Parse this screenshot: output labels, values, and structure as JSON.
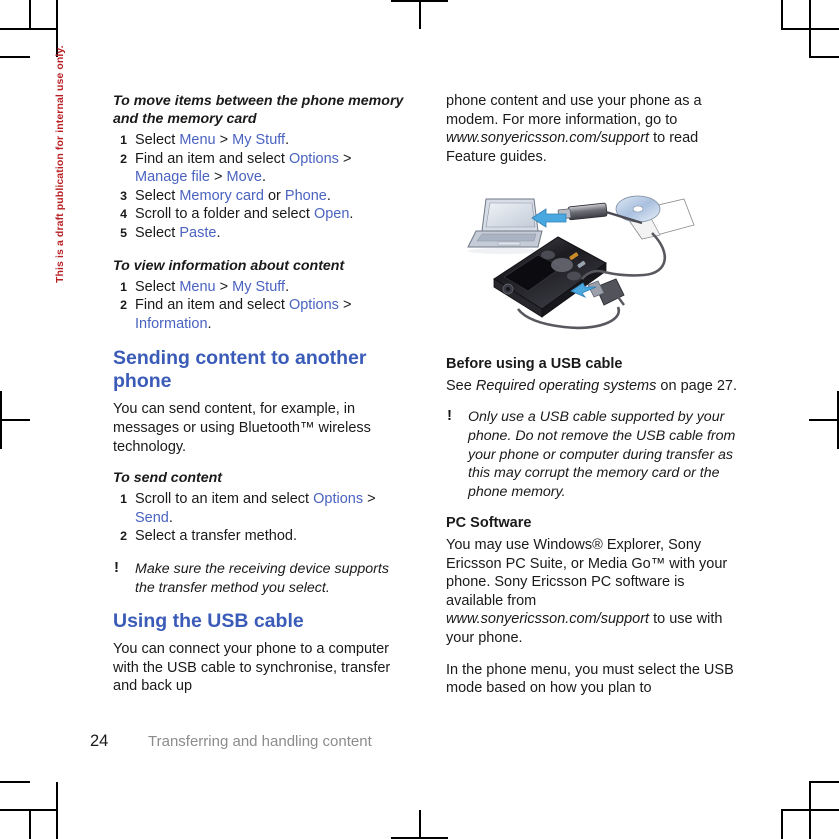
{
  "document": {
    "draft_stamp": "This is a draft publication for internal use only.",
    "footer": {
      "page_number": "24",
      "chapter_title": "Transferring and handling content"
    },
    "accent_heading_color": "#3a5bb7",
    "link_color": "#4a63c0",
    "stamp_color": "#b81f23"
  },
  "left_column": {
    "proc_move": {
      "heading": "To move items between the phone memory and the memory card",
      "steps": [
        {
          "parts": [
            {
              "t": "Select ",
              "s": "plain"
            },
            {
              "t": "Menu",
              "s": "link"
            },
            {
              "t": " > ",
              "s": "plain"
            },
            {
              "t": "My Stuff",
              "s": "link"
            },
            {
              "t": ".",
              "s": "plain"
            }
          ]
        },
        {
          "parts": [
            {
              "t": "Find an item and select ",
              "s": "plain"
            },
            {
              "t": "Options",
              "s": "link"
            },
            {
              "t": " > ",
              "s": "plain"
            },
            {
              "t": "Manage file",
              "s": "link"
            },
            {
              "t": " > ",
              "s": "plain"
            },
            {
              "t": "Move",
              "s": "link"
            },
            {
              "t": ".",
              "s": "plain"
            }
          ]
        },
        {
          "parts": [
            {
              "t": "Select ",
              "s": "plain"
            },
            {
              "t": "Memory card",
              "s": "link"
            },
            {
              "t": " or ",
              "s": "plain"
            },
            {
              "t": "Phone",
              "s": "link"
            },
            {
              "t": ".",
              "s": "plain"
            }
          ]
        },
        {
          "parts": [
            {
              "t": "Scroll to a folder and select ",
              "s": "plain"
            },
            {
              "t": "Open",
              "s": "link"
            },
            {
              "t": ".",
              "s": "plain"
            }
          ]
        },
        {
          "parts": [
            {
              "t": "Select ",
              "s": "plain"
            },
            {
              "t": "Paste",
              "s": "link"
            },
            {
              "t": ".",
              "s": "plain"
            }
          ]
        }
      ]
    },
    "proc_view_info": {
      "heading": "To view information about content",
      "steps": [
        {
          "parts": [
            {
              "t": "Select ",
              "s": "plain"
            },
            {
              "t": "Menu",
              "s": "link"
            },
            {
              "t": " > ",
              "s": "plain"
            },
            {
              "t": "My Stuff",
              "s": "link"
            },
            {
              "t": ".",
              "s": "plain"
            }
          ]
        },
        {
          "parts": [
            {
              "t": "Find an item and select ",
              "s": "plain"
            },
            {
              "t": "Options",
              "s": "link"
            },
            {
              "t": " > ",
              "s": "plain"
            },
            {
              "t": "Information",
              "s": "link"
            },
            {
              "t": ".",
              "s": "plain"
            }
          ]
        }
      ]
    },
    "section_sending": {
      "heading": "Sending content to another phone",
      "body": "You can send content, for example, in messages or using Bluetooth™ wireless technology."
    },
    "proc_send": {
      "heading": "To send content",
      "steps": [
        {
          "parts": [
            {
              "t": "Scroll to an item and select ",
              "s": "plain"
            },
            {
              "t": "Options",
              "s": "link"
            },
            {
              "t": " > ",
              "s": "plain"
            },
            {
              "t": "Send",
              "s": "link"
            },
            {
              "t": ".",
              "s": "plain"
            }
          ]
        },
        {
          "parts": [
            {
              "t": "Select a transfer method.",
              "s": "plain"
            }
          ]
        }
      ]
    },
    "note_receiving": {
      "icon": "exclamation-icon",
      "text": "Make sure the receiving device supports the transfer method you select."
    },
    "section_usb": {
      "heading": "Using the USB cable",
      "body": "You can connect your phone to a computer with the USB cable to synchronise, transfer and back up"
    }
  },
  "right_column": {
    "continued_paragraph": {
      "lead": "phone content and use your phone as a modem. For more information, go to ",
      "url": "www.sonyericsson.com/support",
      "tail": " to read Feature guides."
    },
    "figure": {
      "name": "usb-connection-illustration",
      "caption": "",
      "elements": [
        "laptop",
        "mobile-phone",
        "usb-connector",
        "cd-disc",
        "blue-arrow"
      ]
    },
    "section_before_usb": {
      "heading": "Before using a USB cable",
      "body_lead": "See ",
      "body_italic": "Required operating systems",
      "body_tail": " on page 27."
    },
    "note_usb_caution": {
      "icon": "exclamation-icon",
      "text": "Only use a USB cable supported by your phone. Do not remove the USB cable from your phone or computer during transfer as this may corrupt the memory card or the phone memory."
    },
    "section_pc_software": {
      "heading": "PC Software",
      "body_lead": "You may use Windows® Explorer, Sony Ericsson PC Suite, or Media Go™ with your phone. Sony Ericsson PC software is available from ",
      "url": "www.sonyericsson.com/support",
      "body_tail": " to use with your phone.",
      "body2": "In the phone menu, you must select the USB mode based on how you plan to"
    }
  }
}
